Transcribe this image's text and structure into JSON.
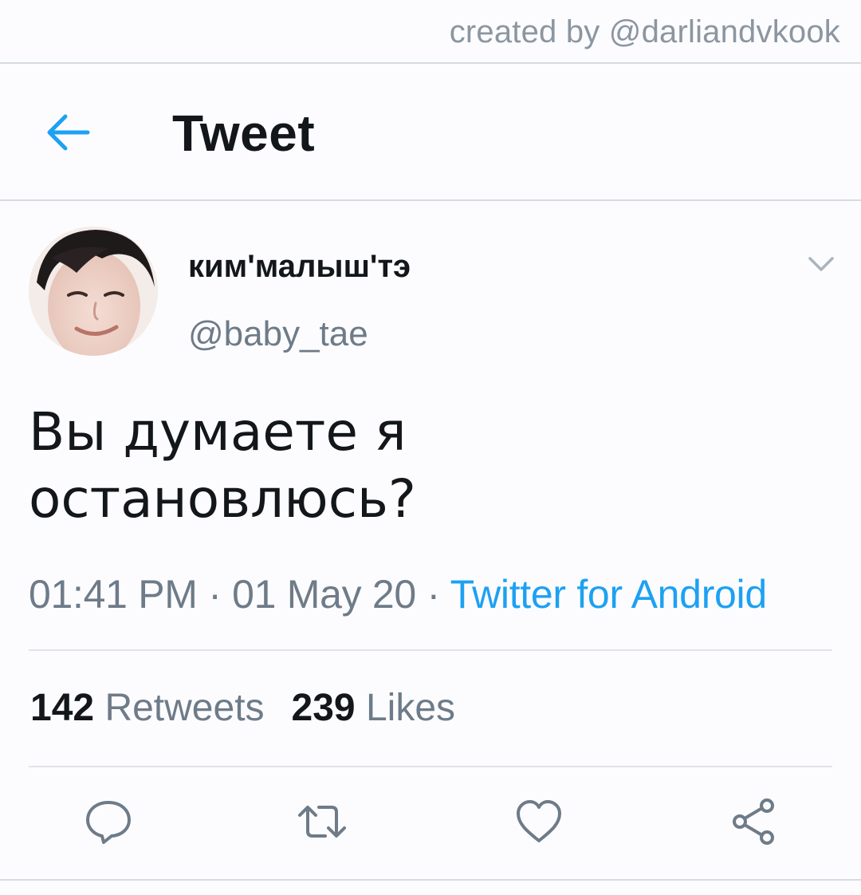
{
  "watermark": "created by @darliandvkook",
  "header": {
    "title": "Tweet",
    "back_icon": "arrow-left-icon",
    "accent_color": "#1da1f2"
  },
  "tweet": {
    "display_name": "ким'малыш'тэ",
    "handle": "@baby_tae",
    "text_lines": [
      "Вы думаете я",
      "остановлюсь?"
    ],
    "time": "01:41 PM",
    "date": "01 May 20",
    "separator": "·",
    "source": "Twitter for Android",
    "retweet_count": "142",
    "retweet_label": "Retweets",
    "like_count": "239",
    "like_label": "Likes"
  },
  "actions": [
    {
      "name": "reply",
      "icon": "reply-icon"
    },
    {
      "name": "retweet",
      "icon": "retweet-icon"
    },
    {
      "name": "like",
      "icon": "heart-icon"
    },
    {
      "name": "share",
      "icon": "share-icon"
    }
  ],
  "colors": {
    "text_primary": "#14171a",
    "text_secondary": "#6e7b88",
    "icon_gray": "#6e7b88",
    "link_blue": "#1da1f2",
    "border": "#d6dbe0"
  }
}
